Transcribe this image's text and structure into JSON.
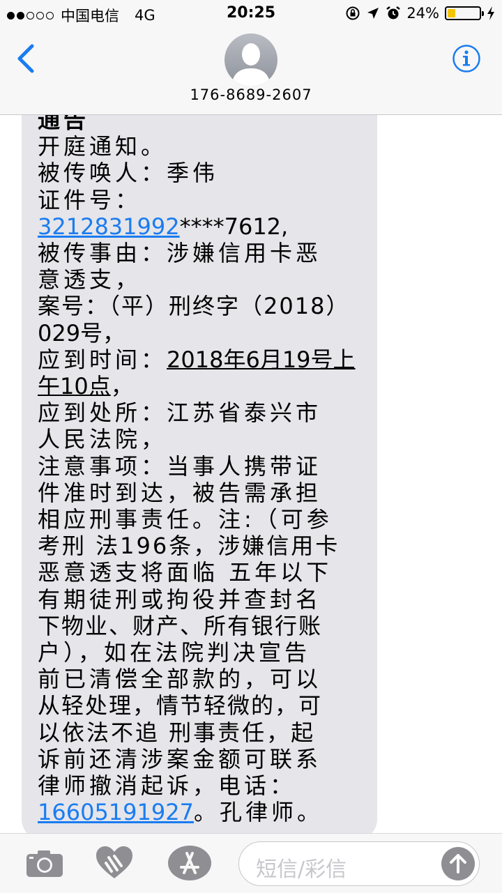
{
  "status_bar": {
    "carrier": "中国电信",
    "network": "4G",
    "time": "20:25",
    "battery": "24%",
    "battery_level": 0.24
  },
  "header": {
    "phone_number": "176-8689-2607"
  },
  "message": {
    "line_01": "通告",
    "line_02": "开庭通知。",
    "line_03": "被传唤人：季伟",
    "line_04": "证件号：",
    "id_link": "3212831992",
    "id_tail": "****7612,",
    "line_05": "被传事由：涉嫌信用卡恶",
    "line_06": "意透支，",
    "line_07": "案号：（平）刑终字（2018）",
    "line_08": "029号，",
    "time_label": "应到时间：",
    "time_value": "2018年6月19号上",
    "time_value_2": "午10点",
    "line_09": "，",
    "line_10": "应到处所：江苏省泰兴市",
    "line_11": "人民法院，",
    "line_12": "注意事项：当事人携带证",
    "line_13": "件准时到达，被告需承担",
    "line_14": "相应刑事责任。注:（可参",
    "line_15": "考刑 法196条，涉嫌信用卡",
    "line_16": "恶意透支将面临 五年以下",
    "line_17": "有期徒刑或拘役并查封名",
    "line_18": "下物业、财产、所有银行账",
    "line_19": "户），如在法院判决宣告",
    "line_20": "前已清偿全部款的，可以",
    "line_21": "从轻处理，情节轻微的，可",
    "line_22": "以依法不追 刑事责任，起",
    "line_23": "诉前还清涉案金额可联系",
    "line_24": "律师撤消起诉，电话：",
    "phone_link": "16605191927",
    "line_25": "。孔律师。"
  },
  "composer": {
    "placeholder": "短信/彩信"
  },
  "icons": {
    "back": "chevron-left-icon",
    "info": "info-icon",
    "camera": "camera-icon",
    "digital_touch": "heart-hands-icon",
    "app_store": "app-store-icon",
    "send": "arrow-up-icon"
  },
  "colors": {
    "accent": "#1a7cf0",
    "bubble": "#e5e5ea",
    "battery": "#f5c400"
  }
}
